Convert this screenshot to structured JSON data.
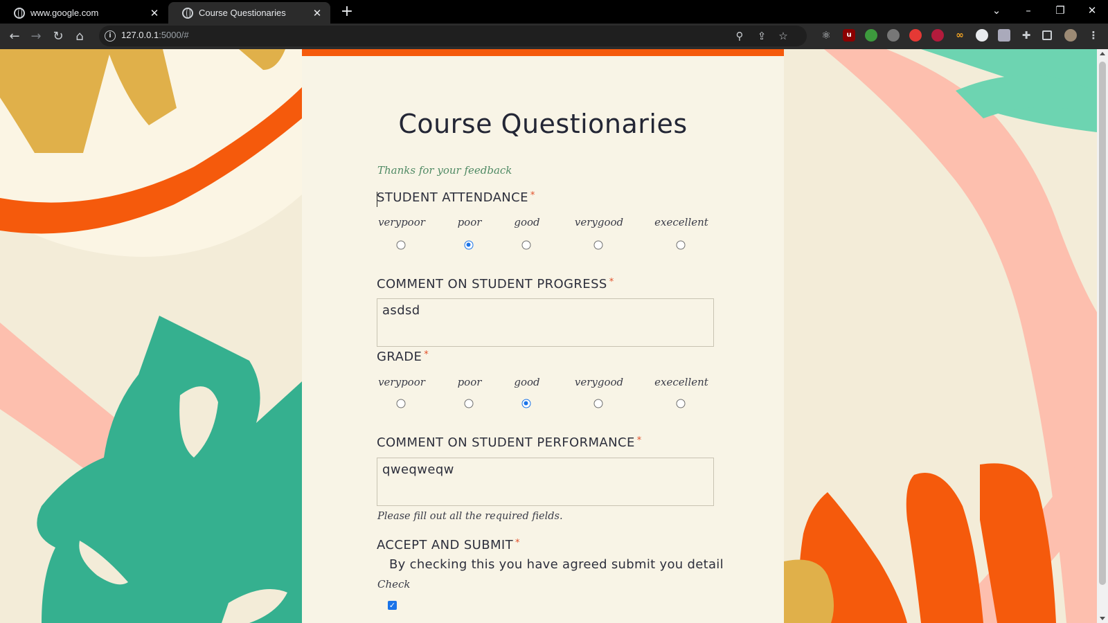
{
  "browser": {
    "tabs": [
      {
        "title": "www.google.com",
        "active": false
      },
      {
        "title": "Course Questionaries",
        "active": true
      }
    ],
    "url_host": "127.0.0.1",
    "url_rest": ":5000/#",
    "extensions": [
      "react-devtools-icon",
      "ublock-icon",
      "extension-icon",
      "extension-icon",
      "pokeball-icon",
      "extension-icon",
      "infinity-icon",
      "extension-icon",
      "extension-icon",
      "puzzle-icon",
      "sidepanel-icon",
      "avatar"
    ]
  },
  "form": {
    "title": "Course Questionaries",
    "thanks": "Thanks for your feedback",
    "required_mark": "*",
    "scale": [
      "verypoor",
      "poor",
      "good",
      "verygood",
      "execellent"
    ],
    "attendance": {
      "label": "STUDENT ATTENDANCE",
      "selected": "poor"
    },
    "progress_comment": {
      "label": "COMMENT ON STUDENT PROGRESS",
      "value": "asdsd"
    },
    "grade": {
      "label": "GRADE",
      "selected": "good"
    },
    "performance_comment": {
      "label": "COMMENT ON STUDENT PERFORMANCE",
      "value": "qweqweqw"
    },
    "hint": "Please fill out all the required fields.",
    "accept": {
      "label": "ACCEPT AND SUBMIT",
      "text": "By checking this you have agreed submit you detail",
      "check_label": "Check",
      "checked": true
    }
  },
  "colors": {
    "accent_orange": "#f55a0c",
    "teal": "#35b08f",
    "pink": "#fdbfae",
    "mustard": "#e0b04a",
    "radio_blue": "#1a73e8",
    "thanks_green": "#4f8a64"
  }
}
